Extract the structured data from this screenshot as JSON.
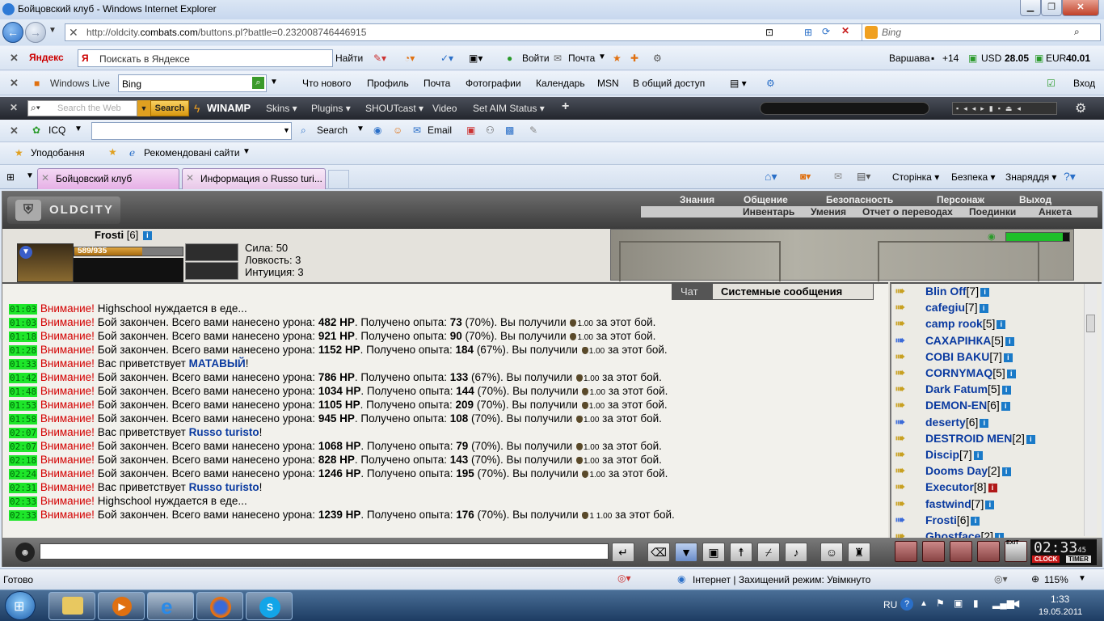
{
  "window": {
    "title": "Бойцовский клуб - Windows Internet Explorer"
  },
  "address": {
    "url_prefix": "http://oldcity.",
    "url_domain": "combats.com",
    "url_suffix": "/buttons.pl?battle=0.232008746446915",
    "search_placeholder": "Bing"
  },
  "yandex": {
    "logo": "Яндекс",
    "search_placeholder": "Поискать в Яндексе",
    "find": "Найти",
    "login": "Войти",
    "mail": "Почта",
    "city": "Варшава",
    "temp": "+14",
    "usd_label": "USD",
    "usd": "28.05",
    "eur_label": "EUR",
    "eur": "40.01"
  },
  "live": {
    "logo": "Windows Live",
    "search_value": "Bing",
    "links": [
      "Что нового",
      "Профиль",
      "Почта",
      "Фотографии",
      "Календарь",
      "MSN",
      "В общий доступ"
    ],
    "login": "Вход"
  },
  "winamp": {
    "search_placeholder": "Search the Web",
    "search_btn": "Search",
    "logo": "WINAMP",
    "menus": [
      "Skins",
      "Plugins",
      "SHOUTcast",
      "Video",
      "Set AIM Status"
    ]
  },
  "icq": {
    "label": "ICQ",
    "search": "Search",
    "email": "Email"
  },
  "favbar": {
    "favorites": "Уподобання",
    "recommended": "Рекомендовані сайти"
  },
  "tabs": [
    {
      "label": "Бойцовский клуб"
    },
    {
      "label": "Информация о Russo turi..."
    }
  ],
  "cmdbar": {
    "page": "Сторінка",
    "safety": "Безпека",
    "tools": "Знаряддя"
  },
  "game": {
    "logo": "OLDCITY",
    "menu_top": [
      "Знания",
      "Общение",
      "Безопасность",
      "Персонаж",
      "Выход"
    ],
    "menu_bottom": [
      "Инвентарь",
      "Умения",
      "Отчет о переводах",
      "Поединки",
      "Анкета"
    ],
    "char": {
      "name": "Frosti",
      "level": "[6]",
      "hp": "589/935",
      "hp_fraction": 0.63,
      "stats": [
        "Сила: 50",
        "Ловкость: 3",
        "Интуиция: 3"
      ]
    },
    "chat_tabs": {
      "chat": "Чат",
      "system": "Системные сообщения"
    },
    "messages": [
      {
        "time": "01:03",
        "warn": "Внимание!",
        "text": "Highschool нуждается в еде..."
      },
      {
        "time": "01:03",
        "warn": "Внимание!",
        "pre": "Бой закончен. Всего вами нанесено урона:",
        "dmg": "482 HP",
        "mid": ". Получено опыта:",
        "exp": "73",
        "pct": "(70%). Вы получили",
        "cur": "1.00",
        "post": "за этот бой."
      },
      {
        "time": "01:18",
        "warn": "Внимание!",
        "pre": "Бой закончен. Всего вами нанесено урона:",
        "dmg": "921 HP",
        "mid": ". Получено опыта:",
        "exp": "90",
        "pct": "(70%). Вы получили",
        "cur": "1.00",
        "post": "за этот бой."
      },
      {
        "time": "01:28",
        "warn": "Внимание!",
        "pre": "Бой закончен. Всего вами нанесено урона:",
        "dmg": "1152 HP",
        "mid": ". Получено опыта:",
        "exp": "184",
        "pct": "(67%). Вы получили",
        "cur": "1.00",
        "post": "за этот бой."
      },
      {
        "time": "01:33",
        "warn": "Внимание!",
        "greet": "Вас приветствует",
        "nick": "МАТАВЫЙ"
      },
      {
        "time": "01:42",
        "warn": "Внимание!",
        "pre": "Бой закончен. Всего вами нанесено урона:",
        "dmg": "786 HP",
        "mid": ". Получено опыта:",
        "exp": "133",
        "pct": "(67%). Вы получили",
        "cur": "1.00",
        "post": "за этот бой."
      },
      {
        "time": "01:48",
        "warn": "Внимание!",
        "pre": "Бой закончен. Всего вами нанесено урона:",
        "dmg": "1034 HP",
        "mid": ". Получено опыта:",
        "exp": "144",
        "pct": "(70%). Вы получили",
        "cur": "1.00",
        "post": "за этот бой."
      },
      {
        "time": "01:53",
        "warn": "Внимание!",
        "pre": "Бой закончен. Всего вами нанесено урона:",
        "dmg": "1105 HP",
        "mid": ". Получено опыта:",
        "exp": "209",
        "pct": "(70%). Вы получили",
        "cur": "1.00",
        "post": "за этот бой."
      },
      {
        "time": "01:58",
        "warn": "Внимание!",
        "pre": "Бой закончен. Всего вами нанесено урона:",
        "dmg": "945 HP",
        "mid": ". Получено опыта:",
        "exp": "108",
        "pct": "(70%). Вы получили",
        "cur": "1.00",
        "post": "за этот бой."
      },
      {
        "time": "02:07",
        "warn": "Внимание!",
        "greet": "Вас приветствует",
        "nick": "Russo turisto"
      },
      {
        "time": "02:07",
        "warn": "Внимание!",
        "pre": "Бой закончен. Всего вами нанесено урона:",
        "dmg": "1068 HP",
        "mid": ". Получено опыта:",
        "exp": "79",
        "pct": "(70%). Вы получили",
        "cur": "1.00",
        "post": "за этот бой."
      },
      {
        "time": "02:18",
        "warn": "Внимание!",
        "pre": "Бой закончен. Всего вами нанесено урона:",
        "dmg": "828 HP",
        "mid": ". Получено опыта:",
        "exp": "143",
        "pct": "(70%). Вы получили",
        "cur": "1.00",
        "post": "за этот бой."
      },
      {
        "time": "02:24",
        "warn": "Внимание!",
        "pre": "Бой закончен. Всего вами нанесено урона:",
        "dmg": "1246 HP",
        "mid": ". Получено опыта:",
        "exp": "195",
        "pct": "(70%). Вы получили",
        "cur": "1.00",
        "post": "за этот бой."
      },
      {
        "time": "02:31",
        "warn": "Внимание!",
        "greet": "Вас приветствует",
        "nick": "Russo turisto"
      },
      {
        "time": "02:33",
        "warn": "Внимание!",
        "text": "Highschool нуждается в еде..."
      },
      {
        "time": "02:33",
        "warn": "Внимание!",
        "pre": "Бой закончен. Всего вами нанесено урона:",
        "dmg": "1239 HP",
        "mid": ". Получено опыта:",
        "exp": "176",
        "pct": "(70%). Вы получили",
        "cur": "1 1.00",
        "post": "за этот бой."
      }
    ],
    "users": [
      {
        "name": "Blin Off",
        "lvl": "[7]"
      },
      {
        "name": "cafegiu",
        "lvl": "[7]"
      },
      {
        "name": "camp rook",
        "lvl": "[5]"
      },
      {
        "name": "САХАРІНКА",
        "lvl": "[5]"
      },
      {
        "name": "COBI BAKU",
        "lvl": "[7]"
      },
      {
        "name": "CORNYMAQ",
        "lvl": "[5]"
      },
      {
        "name": "Dark Fatum",
        "lvl": "[5]"
      },
      {
        "name": "DEMON-EN",
        "lvl": "[6]"
      },
      {
        "name": "deserty",
        "lvl": "[6]"
      },
      {
        "name": "DESTROID MEN",
        "lvl": "[2]"
      },
      {
        "name": "Discip",
        "lvl": "[7]"
      },
      {
        "name": "Dooms Day",
        "lvl": "[2]"
      },
      {
        "name": "Executor",
        "lvl": "[8]"
      },
      {
        "name": "fastwind",
        "lvl": "[7]"
      },
      {
        "name": "Frosti",
        "lvl": "[6]"
      },
      {
        "name": "Ghostface",
        "lvl": "[2]"
      }
    ],
    "clock": {
      "time": "02:33",
      "sec": "45",
      "clock_label": "CLOCK",
      "timer_label": "TIMER",
      "exit": "EXIT"
    }
  },
  "statusbar": {
    "text": "Готово",
    "zone": "Інтернет | Захищений режим: Увімкнуто",
    "zoom": "115%"
  },
  "taskbar": {
    "lang": "RU",
    "time": "1:33",
    "date": "19.05.2011"
  }
}
